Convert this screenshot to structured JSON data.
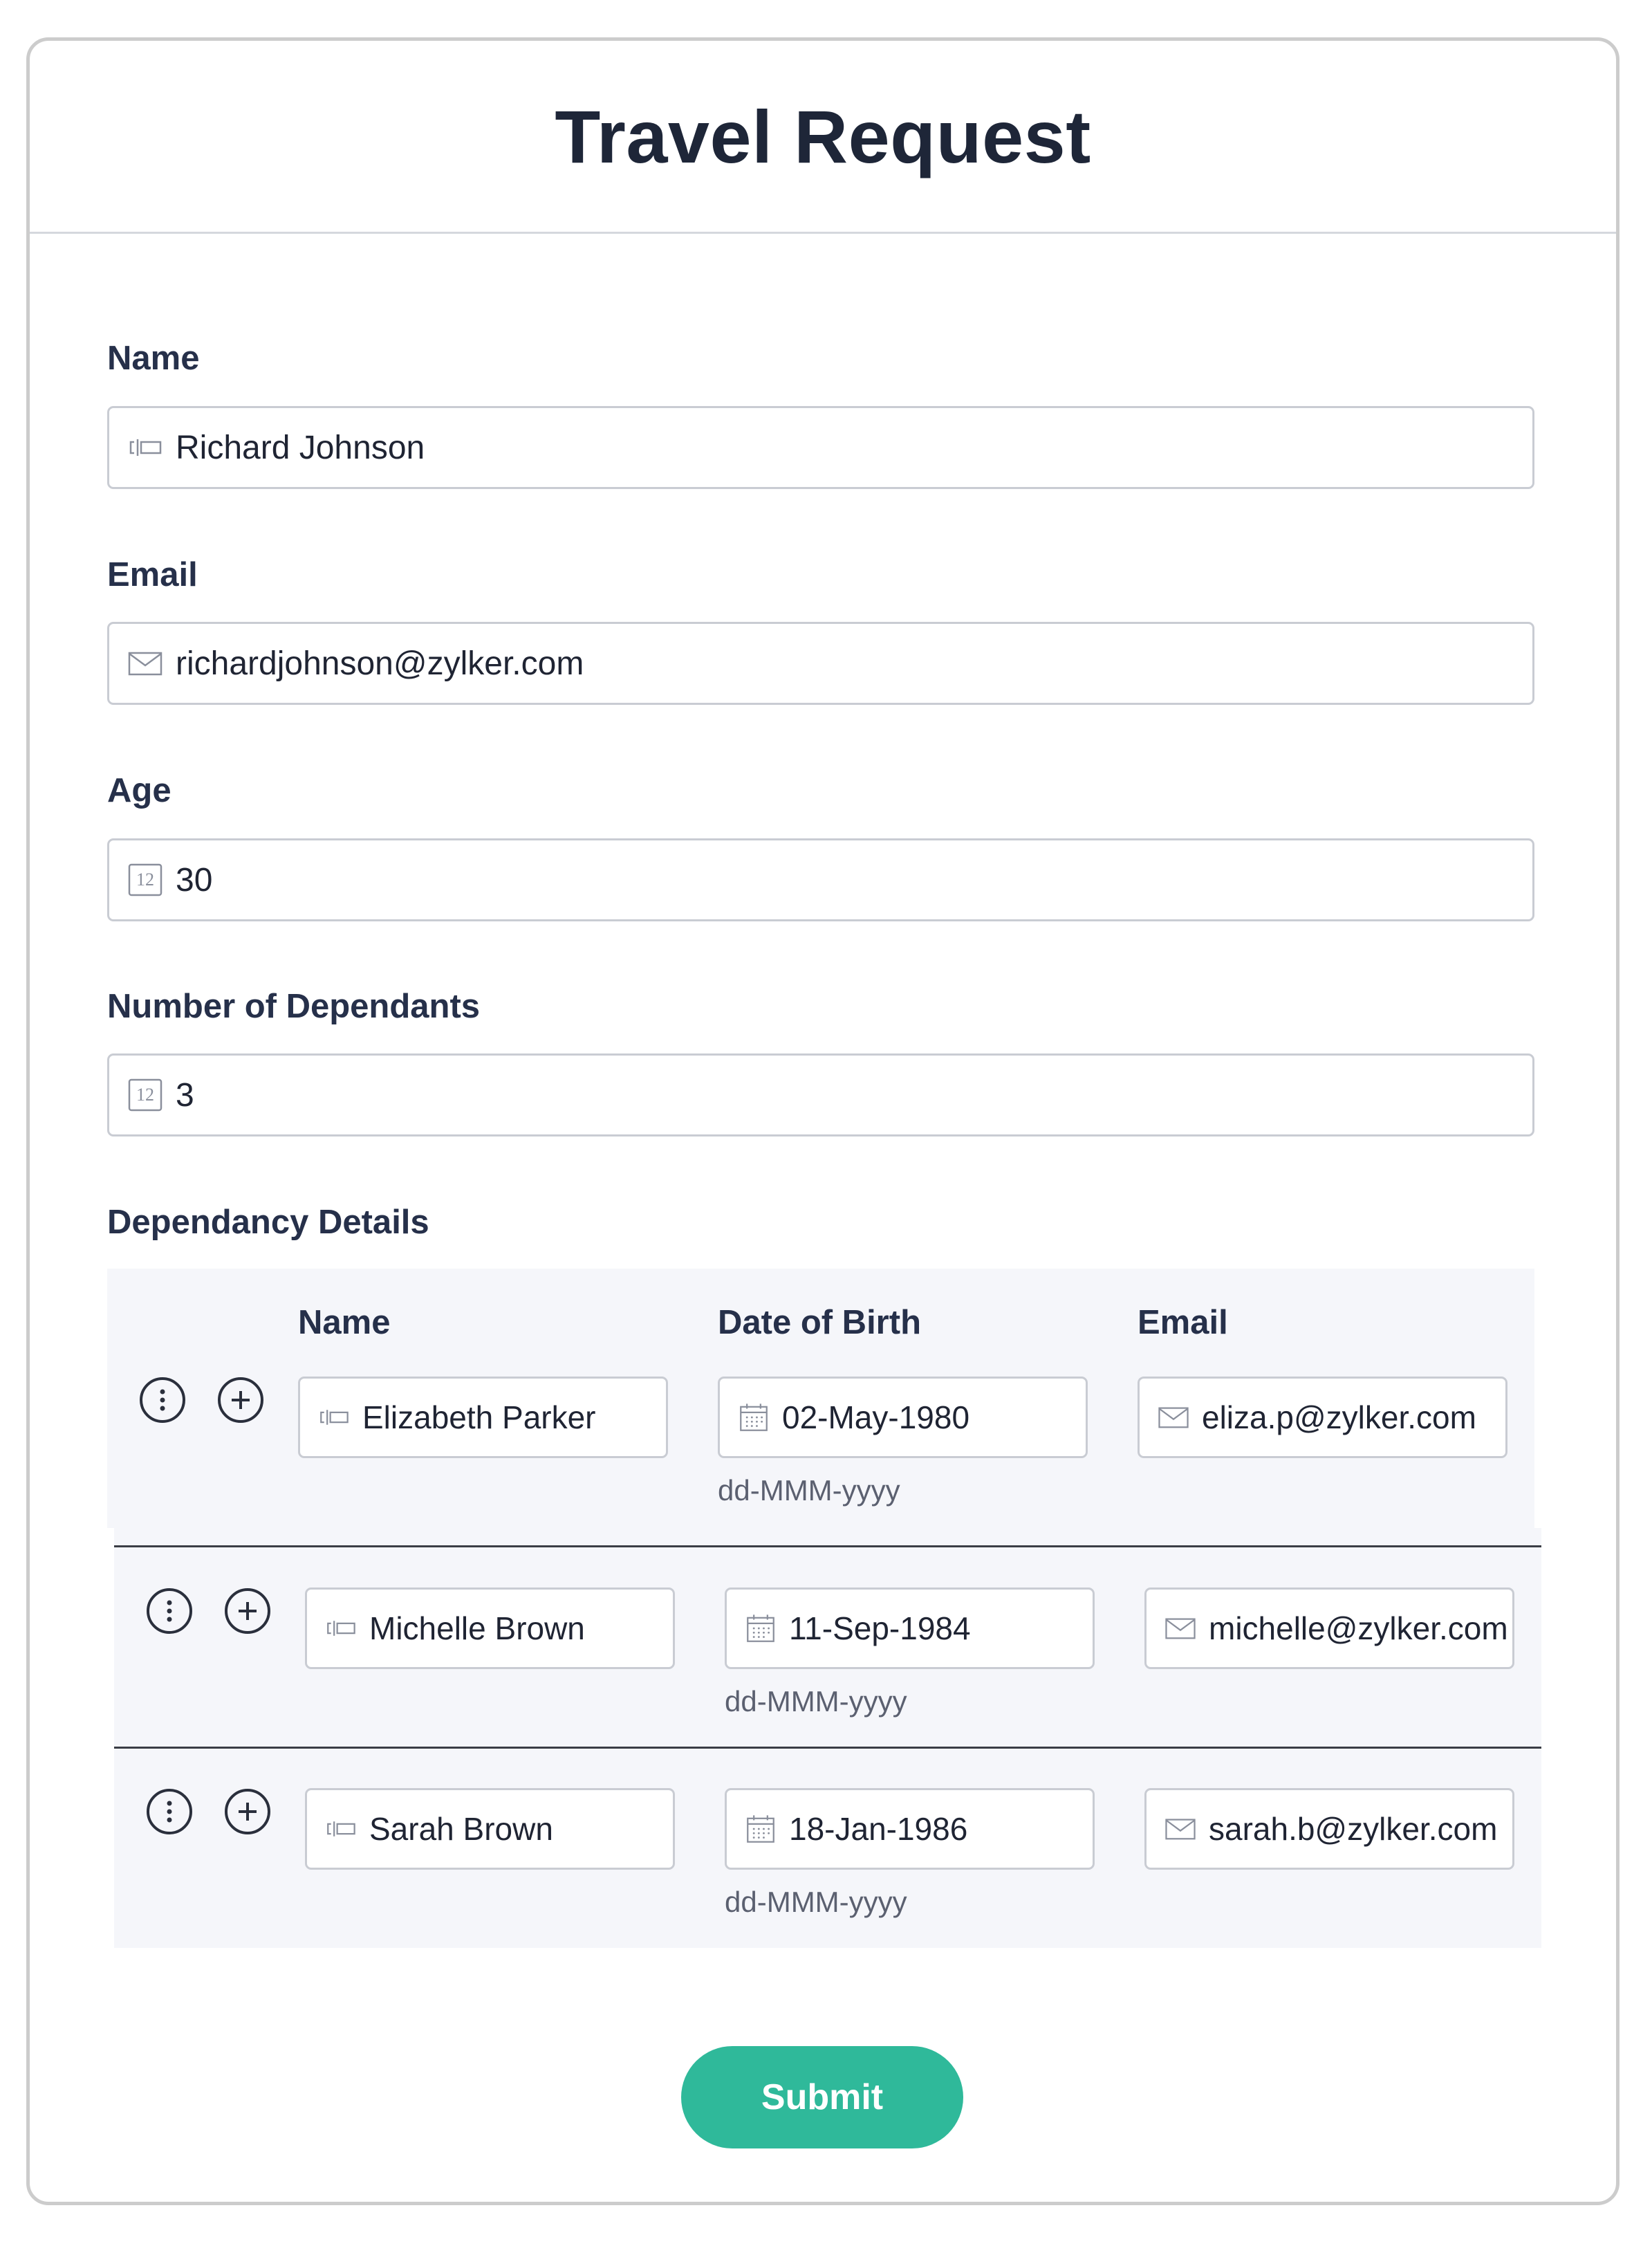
{
  "form": {
    "title": "Travel Request",
    "fields": {
      "name": {
        "label": "Name",
        "value": "Richard Johnson"
      },
      "email": {
        "label": "Email",
        "value": "richardjohnson@zylker.com"
      },
      "age": {
        "label": "Age",
        "value": "30",
        "icon_text": "12"
      },
      "dependants": {
        "label": "Number of Dependants",
        "value": "3",
        "icon_text": "12"
      }
    },
    "dependency": {
      "label": "Dependancy Details",
      "columns": {
        "name": "Name",
        "dob": "Date of Birth",
        "email": "Email"
      },
      "rows": [
        {
          "name": "Elizabeth Parker",
          "dob": "02-May-1980",
          "dob_hint": "dd-MMM-yyyy",
          "email": "eliza.p@zylker.com"
        },
        {
          "name": "Michelle Brown",
          "dob": "11-Sep-1984",
          "dob_hint": "dd-MMM-yyyy",
          "email": "michelle@zylker.com"
        },
        {
          "name": "Sarah Brown",
          "dob": "18-Jan-1986",
          "dob_hint": "dd-MMM-yyyy",
          "email": "sarah.b@zylker.com"
        }
      ]
    },
    "submit_label": "Submit"
  },
  "icons": {
    "text_field": "text-cursor-icon",
    "email": "envelope-icon",
    "number": "number-icon",
    "date": "calendar-icon",
    "row_menu": "vertical-ellipsis-icon",
    "row_add": "plus-circle-icon"
  },
  "colors": {
    "accent": "#2fb99a",
    "subform_background": "#f5f6fa",
    "border": "#c9ccd3"
  }
}
